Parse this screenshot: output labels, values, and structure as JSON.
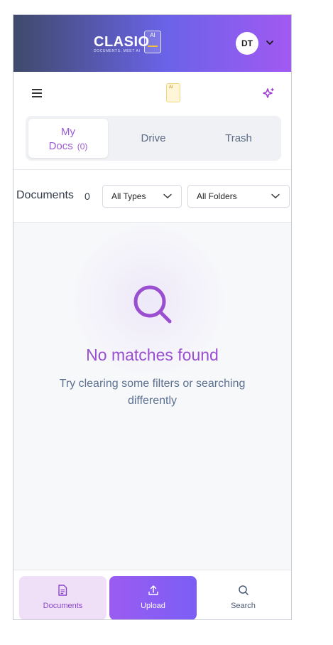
{
  "header": {
    "logo_text": "CLASIO",
    "logo_tagline": "DOCUMENTS, MEET AI",
    "logo_badge": "AI",
    "avatar_initials": "DT",
    "gradient_colors": [
      "#3f4a6b",
      "#6a63e8",
      "#a259f2"
    ]
  },
  "tabs": [
    {
      "label_line1": "My",
      "label_line2": "Docs",
      "count": "(0)",
      "active": true
    },
    {
      "label": "Drive",
      "active": false
    },
    {
      "label": "Trash",
      "active": false
    }
  ],
  "filters": {
    "title": "Documents",
    "count": "0",
    "type_select": {
      "selected": "All Types"
    },
    "folder_select": {
      "selected": "All Folders"
    }
  },
  "empty_state": {
    "icon": "search-icon",
    "title": "No matches found",
    "subtitle": "Try clearing some filters or searching differently"
  },
  "bottom_nav": [
    {
      "label": "Documents",
      "icon": "document-icon",
      "active": true
    },
    {
      "label": "Upload",
      "icon": "upload-icon",
      "primary": true
    },
    {
      "label": "Search",
      "icon": "search-icon"
    }
  ],
  "colors": {
    "accent": "#9a4fd0",
    "active_tab": "#9a5cd6",
    "muted": "#5c7190"
  }
}
